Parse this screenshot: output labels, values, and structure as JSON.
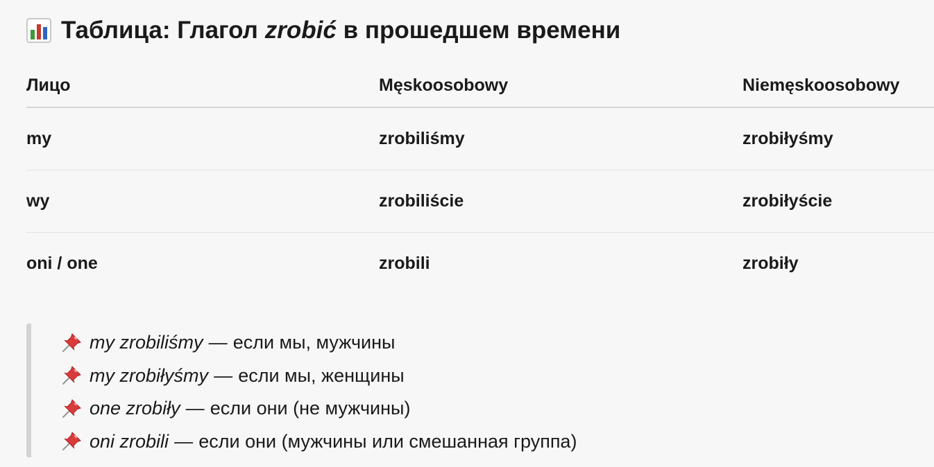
{
  "title": {
    "icon": "bar-chart-icon",
    "prefix": "Таблица: Глагол",
    "verb": "zrobić",
    "suffix": "в прошедшем времени"
  },
  "table": {
    "headers": [
      "Лицо",
      "Męskoosobowy",
      "Niemęskoosobowy"
    ],
    "rows": [
      [
        "my",
        "zrobiliśmy",
        "zrobiłyśmy"
      ],
      [
        "wy",
        "zrobiliście",
        "zrobiłyście"
      ],
      [
        "oni / one",
        "zrobili",
        "zrobiły"
      ]
    ]
  },
  "notes": {
    "icon": "pushpin-icon",
    "items": [
      {
        "phrase": "my zrobiliśmy",
        "dash": "—",
        "explanation": "если мы, мужчины"
      },
      {
        "phrase": "my zrobiłyśmy",
        "dash": "—",
        "explanation": "если мы, женщины"
      },
      {
        "phrase": "one zrobiły",
        "dash": "—",
        "explanation": "если они (не мужчины)"
      },
      {
        "phrase": "oni zrobili",
        "dash": "—",
        "explanation": "если они (мужчины или смешанная группа)"
      }
    ]
  }
}
